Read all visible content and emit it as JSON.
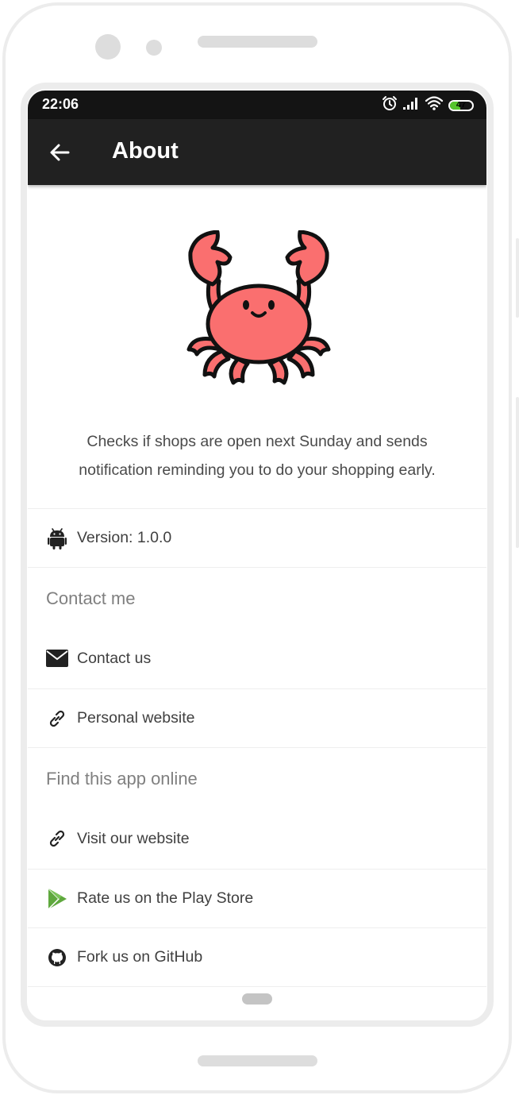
{
  "status_bar": {
    "time": "22:06",
    "battery_level": "47",
    "battery_fraction": 0.47,
    "battery_color": "#55c52c",
    "icons": [
      "alarm-icon",
      "signal-icon",
      "wifi-icon",
      "battery-icon"
    ]
  },
  "app_bar": {
    "back_icon": "arrow-left-icon",
    "title": "About"
  },
  "header": {
    "logo_icon": "crab-icon",
    "description": "Checks if shops are open next Sunday and sends notification reminding you to do your shopping early."
  },
  "version_row": {
    "icon": "android-icon",
    "label": "Version: 1.0.0"
  },
  "sections": [
    {
      "title": "Contact me",
      "items": [
        {
          "icon": "envelope-icon",
          "label": "Contact us"
        },
        {
          "icon": "link-icon",
          "label": "Personal website"
        }
      ]
    },
    {
      "title": "Find this app online",
      "items": [
        {
          "icon": "link-icon",
          "label": "Visit our website"
        },
        {
          "icon": "play-store-icon",
          "label": "Rate us on the Play Store"
        },
        {
          "icon": "github-icon",
          "label": "Fork us on GitHub"
        }
      ]
    }
  ],
  "colors": {
    "status_bar_bg": "#141414",
    "app_bar_bg": "#212121",
    "crab_body": "#fa6f6f",
    "play_store_green": "#5fa83e",
    "section_title": "#808080",
    "row_text": "#404040"
  }
}
